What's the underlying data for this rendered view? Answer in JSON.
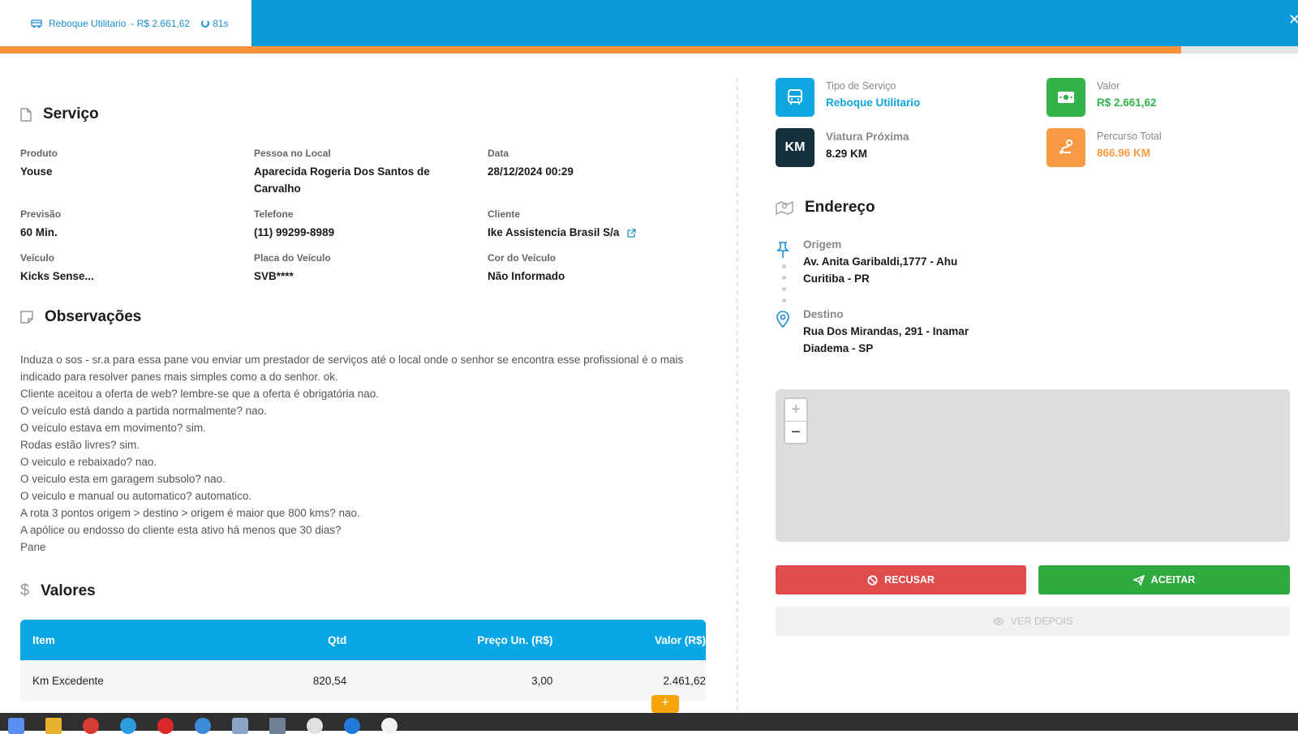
{
  "tab": {
    "title": "Reboque Utilitario",
    "price": "- R$ 2.661,62",
    "timer": "81s"
  },
  "progress": {
    "value": 0.91
  },
  "servico": {
    "title": "Serviço",
    "fields": [
      {
        "label": "Produto",
        "value": "Youse"
      },
      {
        "label": "Pessoa no Local",
        "value": "Aparecida Rogeria Dos Santos de Carvalho"
      },
      {
        "label": "Data",
        "value": "28/12/2024 00:29"
      },
      {
        "label": "Previsão",
        "value": "60 Min."
      },
      {
        "label": "Telefone",
        "value": "(11) 99299-8989"
      },
      {
        "label": "Cliente",
        "value": "Ike Assistencia Brasil S/a"
      },
      {
        "label": "Veículo",
        "value": "Kicks Sense..."
      },
      {
        "label": "Placa do Veículo",
        "value": "SVB****"
      },
      {
        "label": "Cor do Veículo",
        "value": "Não Informado"
      }
    ]
  },
  "observacoes": {
    "title": "Observações",
    "lines": [
      "Induza o sos - sr.a para essa pane vou enviar um prestador de serviços até o local onde o senhor se encontra esse profissional é o mais indicado para resolver panes mais simples como a do senhor. ok.",
      "Cliente aceitou a oferta de web? lembre-se que a oferta é obrigatória nao.",
      "O veículo está dando a partida normalmente? nao.",
      "O veículo estava em movimento? sim.",
      "Rodas estão livres? sim.",
      "O veiculo e rebaixado? nao.",
      "O veiculo esta em garagem subsolo? nao.",
      "O veiculo e manual ou automatico? automatico.",
      "A rota 3 pontos origem > destino > origem é maior que 800 kms? nao.",
      "A apólice ou endosso do cliente esta ativo há menos que 30 dias?",
      "Pane"
    ]
  },
  "valores": {
    "title": "Valores",
    "headers": [
      "Item",
      "Qtd",
      "Preço Un. (R$)",
      "Valor (R$)"
    ],
    "rows": [
      [
        "Km Excedente",
        "820,54",
        "3,00",
        "2.461,62"
      ]
    ],
    "add_label": "+"
  },
  "cards": {
    "tipo": {
      "label": "Tipo de Serviço",
      "value": "Reboque Utilitario",
      "color": "#0da6e0"
    },
    "valor": {
      "label": "Valor",
      "value": "R$ 2.661,62",
      "color": "#33b34a"
    },
    "viatura": {
      "label": "Viatura Próxima",
      "value": "8.29 KM",
      "badge": "KM",
      "color": "#15303d"
    },
    "percurso": {
      "label": "Percurso Total",
      "value": "866.96 KM",
      "color": "#f89a43"
    }
  },
  "endereco": {
    "title": "Endereço",
    "origem": {
      "label": "Origem",
      "line1": "Av. Anita Garibaldi,1777 - Ahu",
      "line2": "Curitiba - PR"
    },
    "destino": {
      "label": "Destino",
      "line1": "Rua Dos Mirandas, 291 - Inamar",
      "line2": "Diadema - SP"
    }
  },
  "map": {
    "zoom_in": "+",
    "zoom_out": "−"
  },
  "actions": {
    "recusar": "RECUSAR",
    "aceitar": "ACEITAR",
    "ver_depois": "VER DEPOIS"
  }
}
